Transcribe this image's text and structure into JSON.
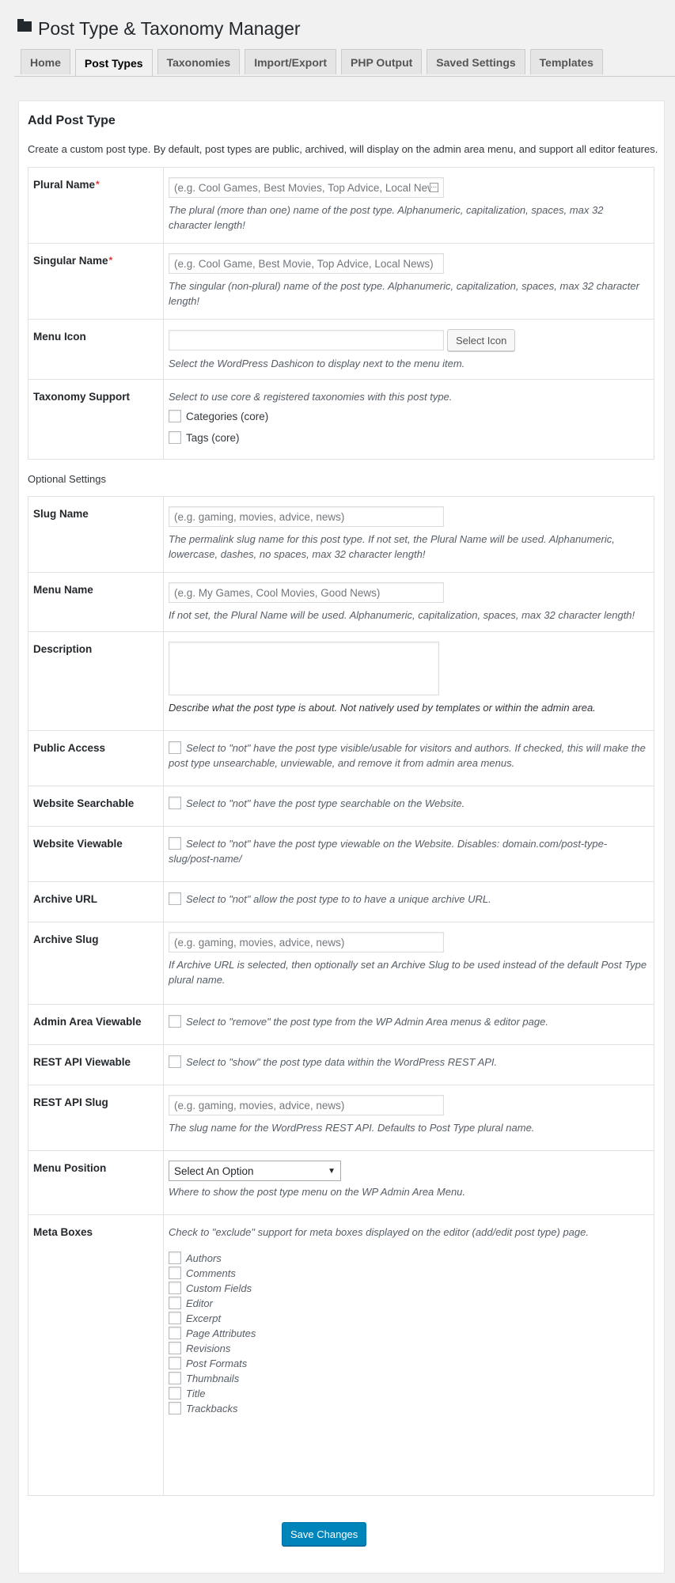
{
  "page": {
    "title": "Post Type & Taxonomy Manager"
  },
  "tabs": [
    "Home",
    "Post Types",
    "Taxonomies",
    "Import/Export",
    "PHP Output",
    "Saved Settings",
    "Templates"
  ],
  "section": {
    "heading": "Add Post Type",
    "intro": "Create a custom post type. By default, post types are public, archived, will display on the admin area menu, and support all editor features."
  },
  "required": {
    "plural": {
      "label": "Plural Name",
      "placeholder": "(e.g. Cool Games, Best Movies, Top Advice, Local News)",
      "desc": "The plural (more than one) name of the post type. Alphanumeric, capitalization, spaces, max 32 character length!"
    },
    "singular": {
      "label": "Singular Name",
      "placeholder": "(e.g. Cool Game, Best Movie, Top Advice, Local News)",
      "desc": "The singular (non-plural) name of the post type. Alphanumeric, capitalization, spaces, max 32 character length!"
    },
    "menu_icon": {
      "label": "Menu Icon",
      "button": "Select Icon",
      "desc": "Select the WordPress Dashicon to display next to the menu item."
    },
    "taxonomy": {
      "label": "Taxonomy Support",
      "desc": "Select to use core & registered taxonomies with this post type.",
      "options": [
        "Categories (core)",
        "Tags (core)"
      ]
    }
  },
  "optional_title": "Optional Settings",
  "optional": {
    "slug": {
      "label": "Slug Name",
      "placeholder": "(e.g. gaming, movies, advice, news)",
      "desc": "The permalink slug name for this post type. If not set, the Plural Name will be used. Alphanumeric, lowercase, dashes, no spaces, max 32 character length!"
    },
    "menu_name": {
      "label": "Menu Name",
      "placeholder": "(e.g. My Games, Cool Movies, Good News)",
      "desc": "If not set, the Plural Name will be used. Alphanumeric, capitalization, spaces, max 32 character length!"
    },
    "description": {
      "label": "Description",
      "desc": "Describe what the post type is about. Not natively used by templates or within the admin area."
    },
    "public_access": {
      "label": "Public Access",
      "desc": "Select to \"not\" have the post type visible/usable for visitors and authors. If checked, this will make the post type unsearchable, unviewable, and remove it from admin area menus."
    },
    "searchable": {
      "label": "Website Searchable",
      "desc": "Select to \"not\" have the post type searchable on the Website."
    },
    "viewable": {
      "label": "Website Viewable",
      "desc": "Select to \"not\" have the post type viewable on the Website. Disables: domain.com/post-type-slug/post-name/"
    },
    "archive_url": {
      "label": "Archive URL",
      "desc": "Select to \"not\" allow the post type to to have a unique archive URL."
    },
    "archive_slug": {
      "label": "Archive Slug",
      "placeholder": "(e.g. gaming, movies, advice, news)",
      "desc": "If Archive URL is selected, then optionally set an Archive Slug to be used instead of the default Post Type plural name."
    },
    "admin_viewable": {
      "label": "Admin Area Viewable",
      "desc": "Select to \"remove\" the post type from the WP Admin Area menus & editor page."
    },
    "rest_viewable": {
      "label": "REST API Viewable",
      "desc": "Select to \"show\" the post type data within the WordPress REST API."
    },
    "rest_slug": {
      "label": "REST API Slug",
      "placeholder": "(e.g. gaming, movies, advice, news)",
      "desc": "The slug name for the WordPress REST API. Defaults to Post Type plural name."
    },
    "menu_position": {
      "label": "Menu Position",
      "selected": "Select An Option",
      "desc": "Where to show the post type menu on the WP Admin Area Menu."
    },
    "meta_boxes": {
      "label": "Meta Boxes",
      "desc": "Check to \"exclude\" support for meta boxes displayed on the editor (add/edit post type) page.",
      "options": [
        "Authors",
        "Comments",
        "Custom Fields",
        "Editor",
        "Excerpt",
        "Page Attributes",
        "Revisions",
        "Post Formats",
        "Thumbnails",
        "Title",
        "Trackbacks"
      ]
    }
  },
  "save_label": "Save Changes"
}
